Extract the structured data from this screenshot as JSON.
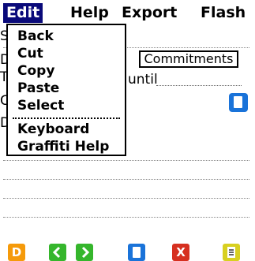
{
  "menubar": {
    "items": [
      "Edit",
      "Help",
      "Export",
      "Flash"
    ]
  },
  "background_letters": [
    "S",
    "D",
    "T",
    "C",
    "D"
  ],
  "form": {
    "commitments_label": "Commitments",
    "until_label": "until"
  },
  "edit_menu": {
    "items": [
      "Back",
      "Cut",
      "Copy",
      "Paste",
      "Select",
      "Keyboard",
      "Graffiti Help"
    ]
  },
  "toolbar": {
    "icons": [
      "d-icon",
      "back-arrow-icon",
      "forward-arrow-icon",
      "new-note-icon",
      "delete-icon",
      "memo-icon"
    ],
    "d_label": "D",
    "delete_label": "X"
  },
  "colors": {
    "menu_highlight": "#0a0a7a",
    "orange": "#f59a0a",
    "green": "#35b62c",
    "blue": "#1a73d9",
    "red": "#d63020",
    "yellow": "#d8d020"
  }
}
